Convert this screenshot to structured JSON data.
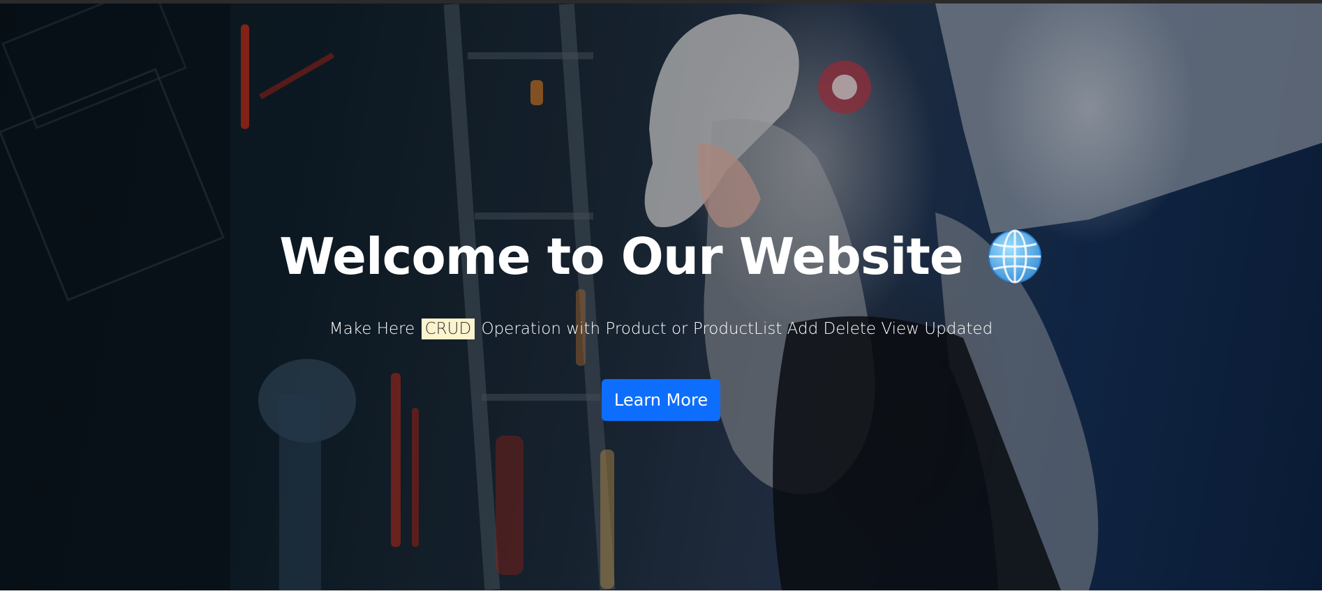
{
  "hero": {
    "title": "Welcome to Our Website",
    "title_icon": "globe-icon",
    "subtitle_before": "Make Here",
    "subtitle_highlight": "CRUD",
    "subtitle_after": "Operation with Product or ProductList Add Delete View Updated",
    "cta_label": "Learn More"
  },
  "colors": {
    "button": "#0d6efd",
    "highlight": "#fcf3cf",
    "text": "#ffffff"
  }
}
